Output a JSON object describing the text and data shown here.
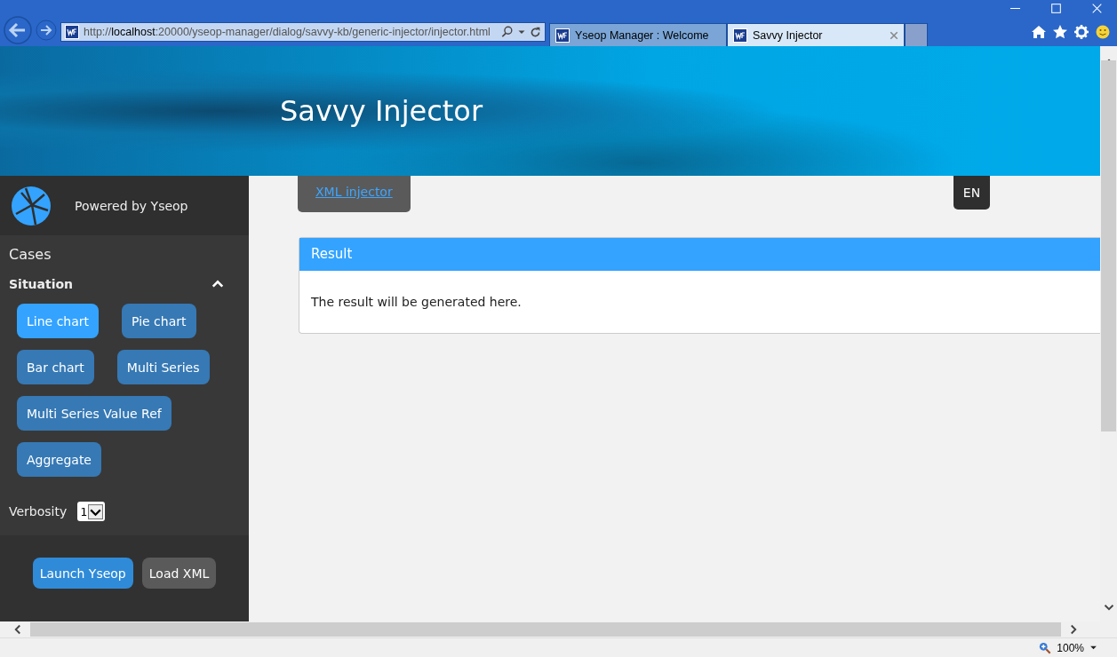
{
  "browser": {
    "url": "http://**localhost**:20000/yseop-manager/dialog/savvy-kb/generic-injector/injector.html",
    "tabs": [
      {
        "title": "Yseop Manager : Welcome",
        "selected": false
      },
      {
        "title": "Savvy Injector",
        "selected": true
      }
    ]
  },
  "page": {
    "title": "Savvy Injector"
  },
  "sidebar": {
    "powered_by": "Powered by Yseop",
    "section": "Cases",
    "group": {
      "title": "Situation",
      "expanded": true
    },
    "cases": [
      {
        "label": "Line chart",
        "selected": true
      },
      {
        "label": "Pie chart",
        "selected": false
      },
      {
        "label": "Bar chart",
        "selected": false
      },
      {
        "label": "Multi Series",
        "selected": false
      },
      {
        "label": "Multi Series Value Ref",
        "selected": false
      },
      {
        "label": "Aggregate",
        "selected": false
      }
    ],
    "verbosity": {
      "label": "Verbosity",
      "value": "1"
    },
    "buttons": [
      {
        "label": "Launch Yseop",
        "kind": "primary"
      },
      {
        "label": "Load XML",
        "kind": "secondary"
      }
    ]
  },
  "main": {
    "tabs": [
      {
        "label": "XML injector"
      }
    ],
    "language": "EN",
    "result": {
      "title": "Result",
      "text": "The result will be generated here."
    }
  },
  "status_bar": {
    "zoom": "100%"
  }
}
